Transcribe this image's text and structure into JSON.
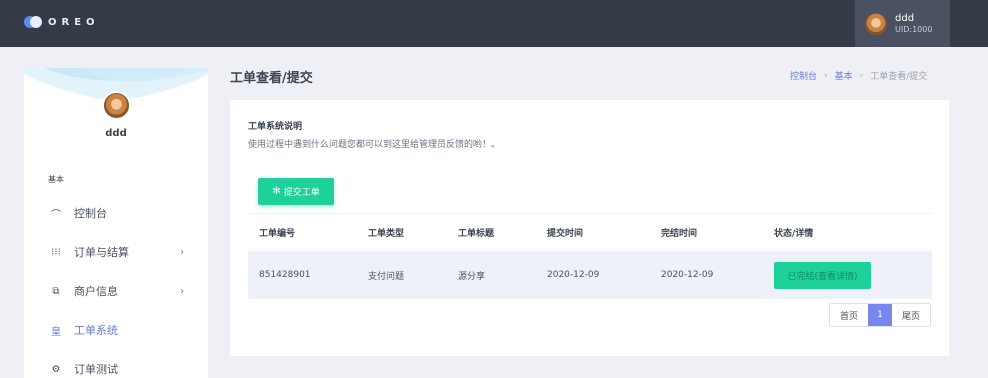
{
  "brand": {
    "logo_text": "OREO"
  },
  "user": {
    "name": "ddd",
    "uid": "UID:1000"
  },
  "sidebar": {
    "name": "ddd",
    "section": "基本",
    "items": [
      {
        "label": "控制台",
        "icon": "speedometer-icon",
        "glyph": "⌒"
      },
      {
        "label": "订单与结算",
        "icon": "grid-icon",
        "glyph": "⁝⁝⁝",
        "arrow": "›"
      },
      {
        "label": "商户信息",
        "icon": "copy-icon",
        "glyph": "⧉",
        "arrow": "›"
      },
      {
        "label": "工单系统",
        "icon": "ticket-icon",
        "glyph": "皇"
      },
      {
        "label": "订单测试",
        "icon": "settings-icon",
        "glyph": "⚙"
      }
    ]
  },
  "page": {
    "title": "工单查看/提交",
    "breadcrumb": [
      "控制台",
      "基本",
      "工单查看/提交"
    ]
  },
  "info": {
    "title": "工单系统说明",
    "desc": "使用过程中遇到什么问题您都可以到这里给管理员反馈的哟！。"
  },
  "submit_button": "提交工单",
  "table": {
    "headers": [
      "工单编号",
      "工单类型",
      "工单标题",
      "提交时间",
      "完结时间",
      "状态/详情"
    ],
    "rows": [
      {
        "id": "851428901",
        "type": "支付问题",
        "title": "源分享",
        "submitted": "2020-12-09",
        "finished": "2020-12-09",
        "status": "已完结(查看详情)"
      }
    ]
  },
  "pager": {
    "first": "首页",
    "current": "1",
    "last": "尾页"
  },
  "colors": {
    "accent": "#1ed19a",
    "primary": "#6a7bd6",
    "topbar": "#343a46"
  }
}
